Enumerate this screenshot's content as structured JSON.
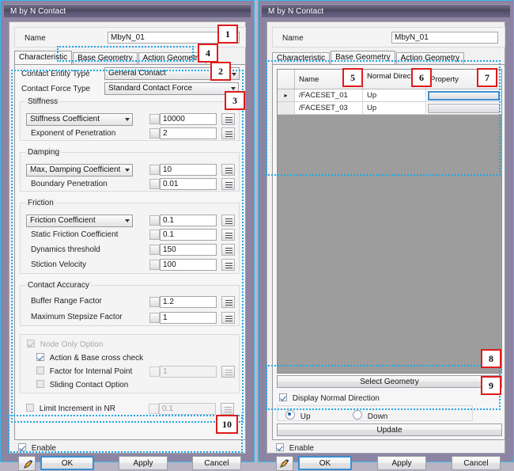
{
  "window_title": "M by N Contact",
  "name_label": "Name",
  "name_value": "MbyN_01",
  "left": {
    "tabs": [
      {
        "label": "Characteristic",
        "active": true
      },
      {
        "label": "Base Geometry",
        "active": false
      },
      {
        "label": "Action Geometry",
        "active": false
      }
    ],
    "contact_entity_type_label": "Contact Entity Type",
    "contact_entity_type_value": "General Contact",
    "contact_force_type_label": "Contact Force Type",
    "contact_force_type_value": "Standard Contact Force",
    "stiffness": {
      "section": "Stiffness",
      "combo_value": "Stiffness Coefficient",
      "combo_field": "10000",
      "row2_label": "Exponent of Penetration",
      "row2_field": "2"
    },
    "damping": {
      "section": "Damping",
      "combo_value": "Max, Damping Coefficient",
      "combo_field": "10",
      "row2_label": "Boundary Penetration",
      "row2_field": "0.01"
    },
    "friction": {
      "section": "Friction",
      "combo_value": "Friction Coefficient",
      "combo_field": "0.1",
      "rows": [
        {
          "label": "Static Friction Coefficient",
          "value": "0.1"
        },
        {
          "label": "Dynamics threshold",
          "value": "150"
        },
        {
          "label": "Stiction Velocity",
          "value": "100"
        }
      ]
    },
    "accuracy": {
      "section": "Contact Accuracy",
      "rows": [
        {
          "label": "Buffer Range Factor",
          "value": "1.2"
        },
        {
          "label": "Maximum Stepsize Factor",
          "value": "1"
        }
      ]
    },
    "node_only": {
      "label": "Node Only Option",
      "cross_check_label": "Action & Base cross check",
      "factor_label": "Factor for Internal Point",
      "factor_value": "1",
      "sliding_label": "Sliding Contact Option"
    },
    "limit_increment_label": "Limit Increment in NR",
    "limit_increment_value": "0.1",
    "enable_label": "Enable",
    "buttons": {
      "ok": "OK",
      "apply": "Apply",
      "cancel": "Cancel"
    }
  },
  "right": {
    "tabs": [
      {
        "label": "Characteristic",
        "active": false
      },
      {
        "label": "Base Geometry",
        "active": true
      },
      {
        "label": "Action Geometry",
        "active": false
      }
    ],
    "table": {
      "headers": [
        "",
        "Name",
        "Normal Direction",
        "Property"
      ],
      "rows": [
        {
          "marker": "▸",
          "name": "/FACESET_01",
          "normal": "Up",
          "property": ""
        },
        {
          "marker": "",
          "name": "/FACESET_03",
          "normal": "Up",
          "property": ""
        }
      ]
    },
    "select_geometry_label": "Select Geometry",
    "display_normal_label": "Display Normal Direction",
    "radio_up": "Up",
    "radio_down": "Down",
    "update_label": "Update",
    "enable_label": "Enable",
    "buttons": {
      "ok": "OK",
      "apply": "Apply",
      "cancel": "Cancel"
    }
  },
  "callouts": [
    {
      "n": "1"
    },
    {
      "n": "2"
    },
    {
      "n": "3"
    },
    {
      "n": "4"
    },
    {
      "n": "5"
    },
    {
      "n": "6"
    },
    {
      "n": "7"
    },
    {
      "n": "8"
    },
    {
      "n": "9"
    },
    {
      "n": "10"
    }
  ]
}
